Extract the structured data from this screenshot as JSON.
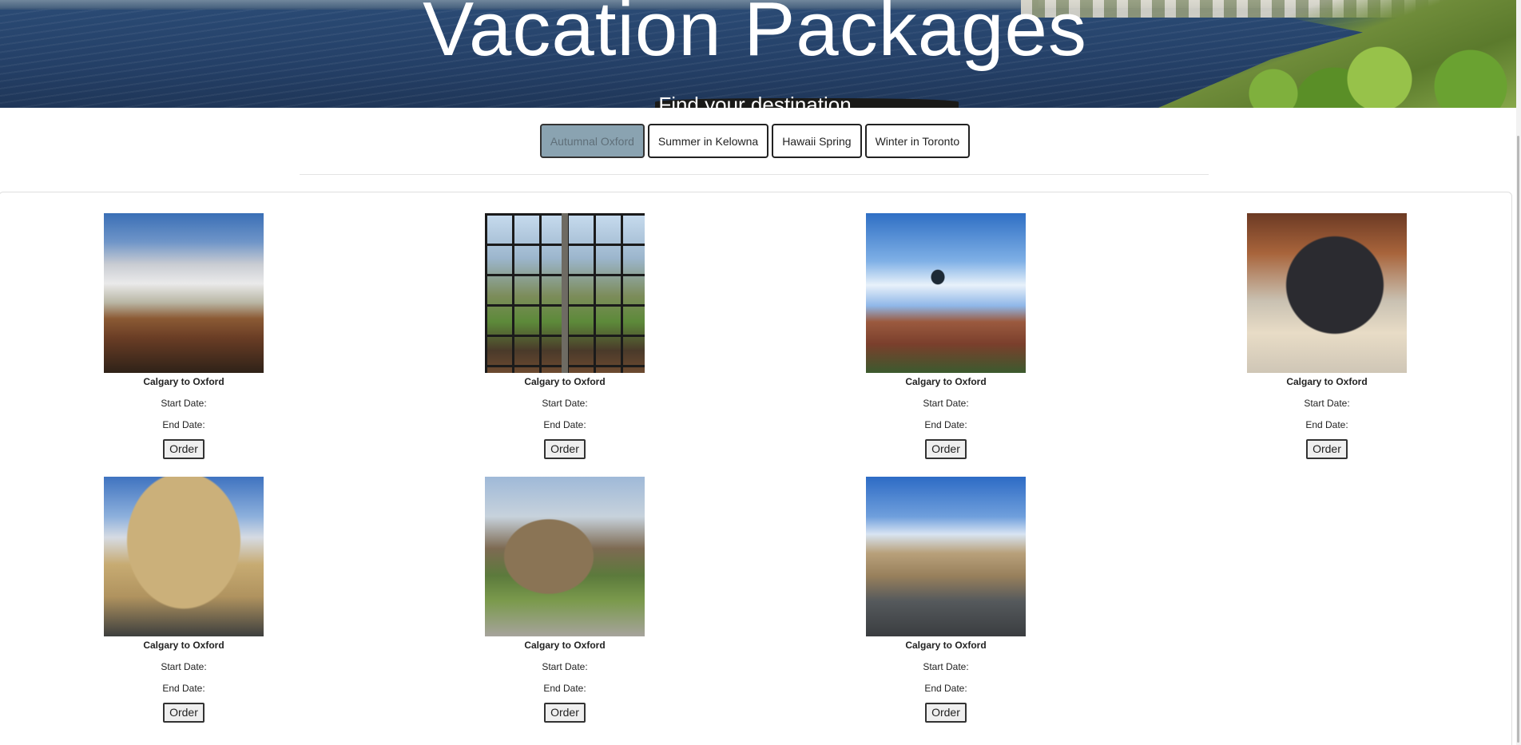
{
  "hero": {
    "title": "Vacation Packages",
    "subtitle": "Find your destination"
  },
  "tabs": [
    {
      "label": "Autumnal Oxford",
      "active": true
    },
    {
      "label": "Summer in Kelowna",
      "active": false
    },
    {
      "label": "Hawaii Spring",
      "active": false
    },
    {
      "label": "Winter in Toronto",
      "active": false
    }
  ],
  "packages": [
    {
      "destination": "Calgary to Oxford",
      "start_label": "Start Date:",
      "end_label": "End Date:",
      "order_label": "Order"
    },
    {
      "destination": "Calgary to Oxford",
      "start_label": "Start Date:",
      "end_label": "End Date:",
      "order_label": "Order"
    },
    {
      "destination": "Calgary to Oxford",
      "start_label": "Start Date:",
      "end_label": "End Date:",
      "order_label": "Order"
    },
    {
      "destination": "Calgary to Oxford",
      "start_label": "Start Date:",
      "end_label": "End Date:",
      "order_label": "Order"
    },
    {
      "destination": "Calgary to Oxford",
      "start_label": "Start Date:",
      "end_label": "End Date:",
      "order_label": "Order"
    },
    {
      "destination": "Calgary to Oxford",
      "start_label": "Start Date:",
      "end_label": "End Date:",
      "order_label": "Order"
    },
    {
      "destination": "Calgary to Oxford",
      "start_label": "Start Date:",
      "end_label": "End Date:",
      "order_label": "Order"
    }
  ],
  "colors": {
    "active_tab_bg": "#8aa3b1",
    "active_tab_text": "#5f6f79",
    "button_bg": "#efefef"
  }
}
